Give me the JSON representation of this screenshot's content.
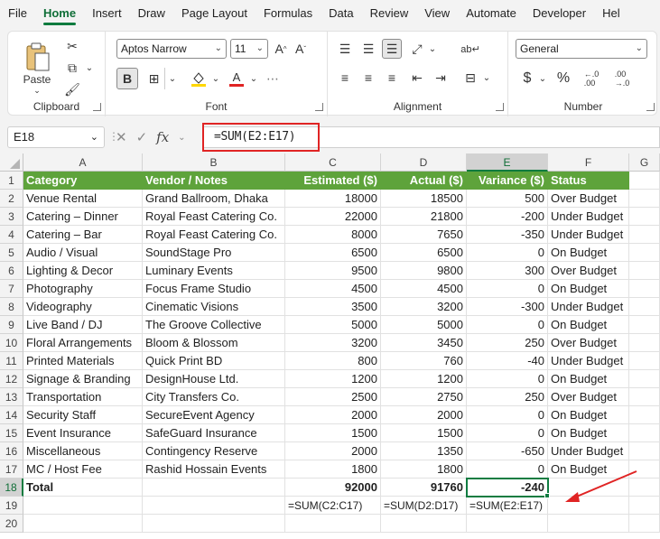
{
  "menu": [
    "File",
    "Home",
    "Insert",
    "Draw",
    "Page Layout",
    "Formulas",
    "Data",
    "Review",
    "View",
    "Automate",
    "Developer",
    "Hel"
  ],
  "ribbon": {
    "clipboard": {
      "paste_label": "Paste",
      "group_label": "Clipboard"
    },
    "font": {
      "name": "Aptos Narrow",
      "size": "11",
      "bold_label": "B",
      "group_label": "Font"
    },
    "alignment": {
      "group_label": "Alignment"
    },
    "number": {
      "format": "General",
      "currency_symbol": "$",
      "percent_symbol": "%",
      "group_label": "Number"
    }
  },
  "formula_bar": {
    "name_box": "E18",
    "fx_label": "fx",
    "formula": "=SUM(E2:E17)"
  },
  "columns": [
    "A",
    "B",
    "C",
    "D",
    "E",
    "F",
    "G"
  ],
  "rows": [
    "1",
    "2",
    "3",
    "4",
    "5",
    "6",
    "7",
    "8",
    "9",
    "10",
    "11",
    "12",
    "13",
    "14",
    "15",
    "16",
    "17",
    "18",
    "19",
    "20"
  ],
  "headers": [
    "Category",
    "Vendor / Notes",
    "Estimated ($)",
    "Actual ($)",
    "Variance ($)",
    "Status"
  ],
  "data_rows": [
    [
      "Venue Rental",
      "Grand Ballroom, Dhaka",
      "18000",
      "18500",
      "500",
      "Over Budget"
    ],
    [
      "Catering – Dinner",
      "Royal Feast Catering Co.",
      "22000",
      "21800",
      "-200",
      "Under Budget"
    ],
    [
      "Catering – Bar",
      "Royal Feast Catering Co.",
      "8000",
      "7650",
      "-350",
      "Under Budget"
    ],
    [
      "Audio / Visual",
      "SoundStage Pro",
      "6500",
      "6500",
      "0",
      "On Budget"
    ],
    [
      "Lighting & Decor",
      "Luminary Events",
      "9500",
      "9800",
      "300",
      "Over Budget"
    ],
    [
      "Photography",
      "Focus Frame Studio",
      "4500",
      "4500",
      "0",
      "On Budget"
    ],
    [
      "Videography",
      "Cinematic Visions",
      "3500",
      "3200",
      "-300",
      "Under Budget"
    ],
    [
      "Live Band / DJ",
      "The Groove Collective",
      "5000",
      "5000",
      "0",
      "On Budget"
    ],
    [
      "Floral Arrangements",
      "Bloom & Blossom",
      "3200",
      "3450",
      "250",
      "Over Budget"
    ],
    [
      "Printed Materials",
      "Quick Print BD",
      "800",
      "760",
      "-40",
      "Under Budget"
    ],
    [
      "Signage & Branding",
      "DesignHouse Ltd.",
      "1200",
      "1200",
      "0",
      "On Budget"
    ],
    [
      "Transportation",
      "City Transfers Co.",
      "2500",
      "2750",
      "250",
      "Over Budget"
    ],
    [
      "Security Staff",
      "SecureEvent Agency",
      "2000",
      "2000",
      "0",
      "On Budget"
    ],
    [
      "Event Insurance",
      "SafeGuard Insurance",
      "1500",
      "1500",
      "0",
      "On Budget"
    ],
    [
      "Miscellaneous",
      "Contingency Reserve",
      "2000",
      "1350",
      "-650",
      "Under Budget"
    ],
    [
      "MC / Host Fee",
      "Rashid Hossain Events",
      "1800",
      "1800",
      "0",
      "On Budget"
    ]
  ],
  "total_row": [
    "Total",
    "",
    "92000",
    "91760",
    "-240",
    ""
  ],
  "formula_notes": [
    "=SUM(C2:C17)",
    "=SUM(D2:D17)",
    "=SUM(E2:E17)"
  ],
  "colors": {
    "header_green": "#5ea33b",
    "accent_green": "#107c41",
    "highlight_red": "#e02424"
  }
}
